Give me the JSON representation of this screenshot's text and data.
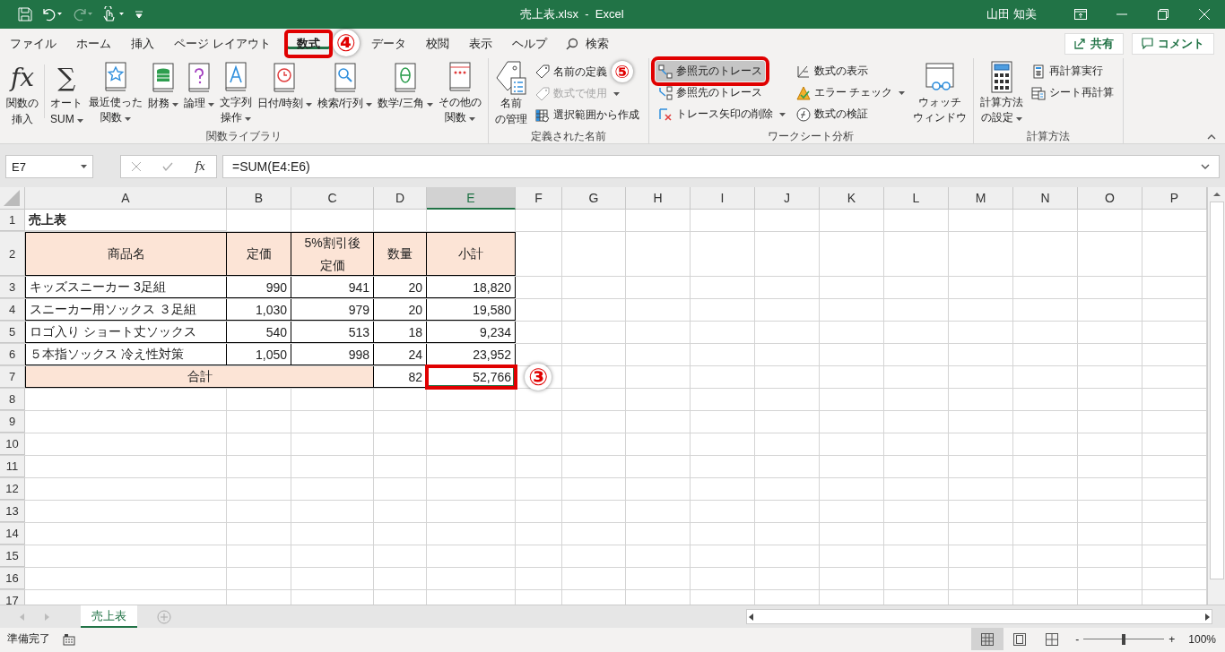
{
  "title_bar": {
    "title": "売上表.xlsx  -  Excel",
    "user": "山田 知美",
    "redo_disabled": true
  },
  "ribbon_tabs": [
    {
      "label": "ファイル",
      "selected": false
    },
    {
      "label": "ホーム",
      "selected": false
    },
    {
      "label": "挿入",
      "selected": false
    },
    {
      "label": "ページ レイアウト",
      "selected": false
    },
    {
      "label": "数式",
      "selected": true,
      "highlighted": true,
      "callout": "④"
    },
    {
      "label": "データ",
      "selected": false
    },
    {
      "label": "校閲",
      "selected": false
    },
    {
      "label": "表示",
      "selected": false
    },
    {
      "label": "ヘルプ",
      "selected": false
    }
  ],
  "search": {
    "label": "検索"
  },
  "share_button": "共有",
  "comment_button": "コメント",
  "groups": [
    {
      "label": "関数ライブラリ",
      "items": [
        {
          "kind": "large",
          "label": [
            "関数の",
            "挿入"
          ],
          "glyph": "fx"
        },
        {
          "kind": "separator"
        },
        {
          "kind": "large",
          "label": [
            "オート",
            "SUM"
          ],
          "glyph": "∑",
          "dropdown": true
        },
        {
          "kind": "large",
          "label": [
            "最近使った",
            "関数"
          ],
          "dropdown": true
        },
        {
          "kind": "large",
          "label": [
            "財務"
          ],
          "dropdown": true
        },
        {
          "kind": "large",
          "label": [
            "論理"
          ],
          "dropdown": true
        },
        {
          "kind": "large",
          "label": [
            "文字列",
            "操作"
          ],
          "dropdown": true
        },
        {
          "kind": "large",
          "label": [
            "日付/時刻"
          ],
          "dropdown": true
        },
        {
          "kind": "large",
          "label": [
            "検索/行列"
          ],
          "dropdown": true
        },
        {
          "kind": "large",
          "label": [
            "数学/三角"
          ],
          "dropdown": true
        },
        {
          "kind": "large",
          "label": [
            "その他の",
            "関数"
          ],
          "dropdown": true
        }
      ]
    },
    {
      "label": "定義された名前",
      "items": [
        {
          "kind": "large",
          "label": [
            "名前",
            "の管理"
          ]
        },
        {
          "kind": "column",
          "items": [
            {
              "label": "名前の定義",
              "callout": "⑤"
            },
            {
              "label": "数式で使用",
              "disabled": true,
              "dropdown": true
            },
            {
              "label": "選択範囲から作成"
            }
          ]
        }
      ]
    },
    {
      "label": "ワークシート分析",
      "items": [
        {
          "kind": "column",
          "items": [
            {
              "label": "参照元のトレース",
              "highlighted": true
            },
            {
              "label": "参照先のトレース"
            },
            {
              "label": "トレース矢印の削除",
              "dropdown": true
            }
          ]
        },
        {
          "kind": "column",
          "items": [
            {
              "label": "数式の表示"
            },
            {
              "label": "エラー チェック",
              "dropdown": true
            },
            {
              "label": "数式の検証"
            }
          ]
        },
        {
          "kind": "large",
          "label": [
            "ウォッチ",
            "ウィンドウ"
          ]
        }
      ]
    },
    {
      "label": "計算方法",
      "items": [
        {
          "kind": "large",
          "label": [
            "計算方法",
            "の設定"
          ],
          "dropdown": true
        },
        {
          "kind": "column",
          "items": [
            {
              "label": "再計算実行"
            },
            {
              "label": "シート再計算"
            }
          ]
        }
      ]
    }
  ],
  "formula_bar": {
    "name_box": "E7",
    "fx": "fx",
    "formula": "=SUM(E4:E6)"
  },
  "sheet": {
    "columns": [
      {
        "label": "A",
        "selected": false
      },
      {
        "label": "B",
        "selected": false
      },
      {
        "label": "C",
        "selected": false
      },
      {
        "label": "D",
        "selected": false
      },
      {
        "label": "E",
        "selected": true
      },
      {
        "label": "F",
        "selected": false
      },
      {
        "label": "G",
        "selected": false
      },
      {
        "label": "H",
        "selected": false
      },
      {
        "label": "I",
        "selected": false
      },
      {
        "label": "J",
        "selected": false
      },
      {
        "label": "K",
        "selected": false
      },
      {
        "label": "L",
        "selected": false
      },
      {
        "label": "M",
        "selected": false
      },
      {
        "label": "N",
        "selected": false
      },
      {
        "label": "O",
        "selected": false
      },
      {
        "label": "P",
        "selected": false
      }
    ],
    "row_numbers": [
      "1",
      "2",
      "3",
      "4",
      "5",
      "6",
      "7",
      "8",
      "9",
      "10",
      "11",
      "12",
      "13",
      "14",
      "15",
      "16",
      "17"
    ],
    "title": "売上表",
    "header": [
      [
        "商品名"
      ],
      [
        "定価"
      ],
      [
        "5%割引後",
        "定価"
      ],
      [
        "数量"
      ],
      [
        "小計"
      ]
    ],
    "items": [
      {
        "name": "キッズスニーカー 3足組",
        "price": "990",
        "discounted": "941",
        "qty": "20",
        "subtotal": "18,820"
      },
      {
        "name": "スニーカー用ソックス ３足組",
        "price": "1,030",
        "discounted": "979",
        "qty": "20",
        "subtotal": "19,580"
      },
      {
        "name": "ロゴ入り ショート丈ソックス",
        "price": "540",
        "discounted": "513",
        "qty": "18",
        "subtotal": "9,234"
      },
      {
        "name": "５本指ソックス 冷え性対策",
        "price": "1,050",
        "discounted": "998",
        "qty": "24",
        "subtotal": "23,952"
      }
    ],
    "total": {
      "label": "合計",
      "qty": "82",
      "subtotal": "52,766",
      "selected": true,
      "highlighted": true,
      "callout": "③"
    }
  },
  "sheet_tabs": [
    {
      "label": "売上表",
      "selected": true
    }
  ],
  "status_bar": {
    "status": "準備完了",
    "views": [
      {
        "selected": true
      },
      {
        "selected": false
      },
      {
        "selected": false
      }
    ],
    "zoom_out": "-",
    "zoom_in": "+",
    "zoom": {
      "level": 0.5,
      "label": "100%"
    }
  }
}
